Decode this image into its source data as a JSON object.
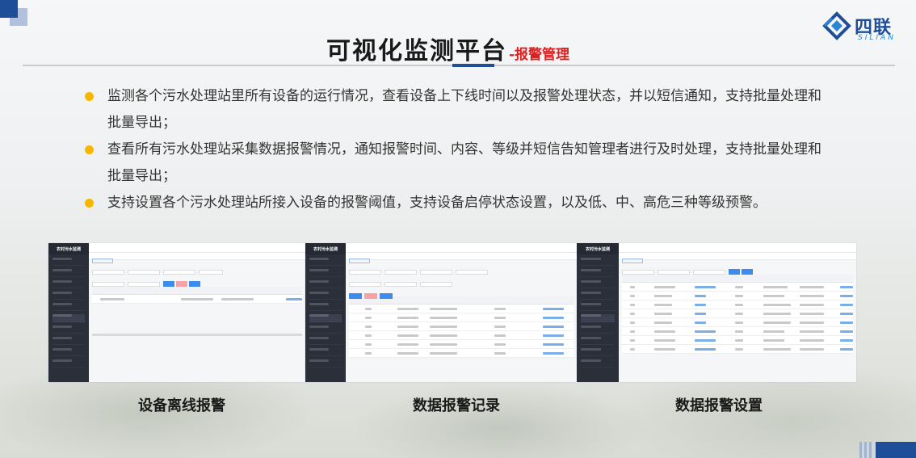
{
  "page": {
    "title_main": "可视化监测平台",
    "title_sub": "-报警管理"
  },
  "logo": {
    "name_cn": "四联",
    "name_en": "SILIAN"
  },
  "bullets": [
    "监测各个污水处理站里所有设备的运行情况，查看设备上下线时间以及报警处理状态，并以短信通知，支持批量处理和批量导出；",
    "查看所有污水处理站采集数据报警情况，通知报警时间、内容、等级并短信告知管理者进行及时处理，支持批量处理和批量导出；",
    "支持设置各个污水处理站所接入设备的报警阈值，支持设备启停状态设置，以及低、中、高危三种等级预警。"
  ],
  "screenshots": [
    {
      "caption": "设备离线报警",
      "app_title": "农村污水监测"
    },
    {
      "caption": "数据报警记录",
      "app_title": "农村污水监测"
    },
    {
      "caption": "数据报警设置",
      "app_title": "农村污水监测"
    }
  ],
  "colors": {
    "accent": "#1f4e99",
    "title_sub": "#e02020",
    "bullet_dot": "#f5b700"
  }
}
